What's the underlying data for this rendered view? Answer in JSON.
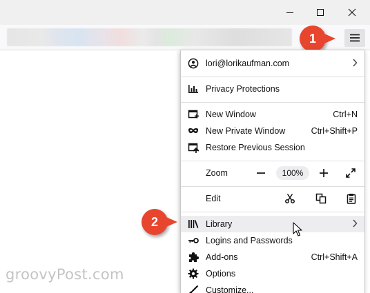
{
  "callouts": {
    "step1": "1",
    "step2": "2"
  },
  "account": {
    "email": "lori@lorikaufman.com"
  },
  "menu": {
    "privacy": "Privacy Protections",
    "new_window": {
      "label": "New Window",
      "shortcut": "Ctrl+N"
    },
    "new_private_window": {
      "label": "New Private Window",
      "shortcut": "Ctrl+Shift+P"
    },
    "restore_session": "Restore Previous Session",
    "zoom": {
      "label": "Zoom",
      "level": "100%"
    },
    "edit": {
      "label": "Edit"
    },
    "library": "Library",
    "logins": "Logins and Passwords",
    "addons": {
      "label": "Add-ons",
      "shortcut": "Ctrl+Shift+A"
    },
    "options": "Options",
    "customize": "Customize..."
  },
  "watermark": "groovyPost.com",
  "colors": {
    "callout": "#e8452f",
    "hover_row": "#ededf0"
  }
}
